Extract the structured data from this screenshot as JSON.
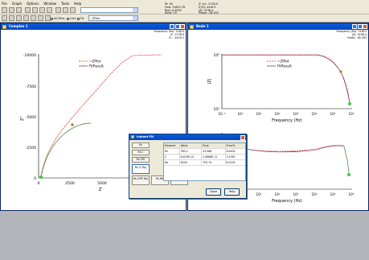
{
  "menu": [
    "File",
    "Graph",
    "Options",
    "Window",
    "Tools",
    "Help"
  ],
  "toolbar": {
    "all_files_label": "All Files",
    "line_label": "Line",
    "fit_label": "Fit",
    "plot_combo_value": "~ZPlot",
    "top_readout": {
      "line1": "Pt: 16",
      "line2": "Freq: 31622.78",
      "line3": "Bias: 0.0039",
      "line4": "Ampl: 10"
    },
    "right_readout": {
      "line1": "Z' (a): -2738.9",
      "line2": "Z'(b): 4418.3",
      "line3": "|Z|: 5198.4",
      "line4": "Phase: -58.205"
    }
  },
  "windows": {
    "complex": {
      "title": "Complex 1",
      "readout": [
        "Frequency (Hz): 31623",
        "Z': 2738.9",
        "Z'': -4418.3"
      ],
      "legend": [
        "~ZPlot",
        "FitResult"
      ],
      "x_label": "Z'",
      "y_label": "Z''",
      "x_ticks": [
        "0",
        "2500",
        "5000",
        "7500",
        "10000"
      ],
      "y_ticks": [
        "-10000",
        "-7500",
        "-5000",
        "-2500",
        "0"
      ]
    },
    "bode": {
      "title": "Bode 1",
      "readout": [
        "Frequency (Hz): 31623",
        "|Z|: 5198.4",
        "theta: -58.205"
      ],
      "legend": [
        "~ZPlot",
        "FitResult"
      ],
      "mag_y_label": "|Z|",
      "mag_y_ticks": [
        "10⁴",
        "10³"
      ],
      "x_ticks": [
        "10⁻¹",
        "10⁰",
        "10¹",
        "10²",
        "10³",
        "10⁴",
        "10⁵",
        "10⁶"
      ],
      "x_label": "Frequency (Hz)",
      "x_label_bottom": "Frequency (Hz)"
    }
  },
  "dialog": {
    "title": "Instant Fit",
    "models": [
      "Rs",
      "Rs C",
      "Rs CPE",
      "Rs (C Rp)",
      "Rs (CPE Rp)",
      "Rs Wo",
      "Rs Ws"
    ],
    "table_header": [
      "Element",
      "Value",
      "Error",
      "Error%"
    ],
    "table_rows": [
      [
        "Rs",
        "390.2",
        "23.586",
        "6.6402"
      ],
      [
        "C",
        "6.429E-10",
        "2.0668E-11",
        "3.2097"
      ],
      [
        "Rp",
        "9249",
        "702.74",
        "8.0191"
      ]
    ],
    "buttons": {
      "close": "Close",
      "help": "Help"
    }
  },
  "colors": {
    "accent": "#0054e3",
    "data_series": "#e53935",
    "fit_series": "#2e7d32",
    "dark_series": "#5a2a6a"
  }
}
